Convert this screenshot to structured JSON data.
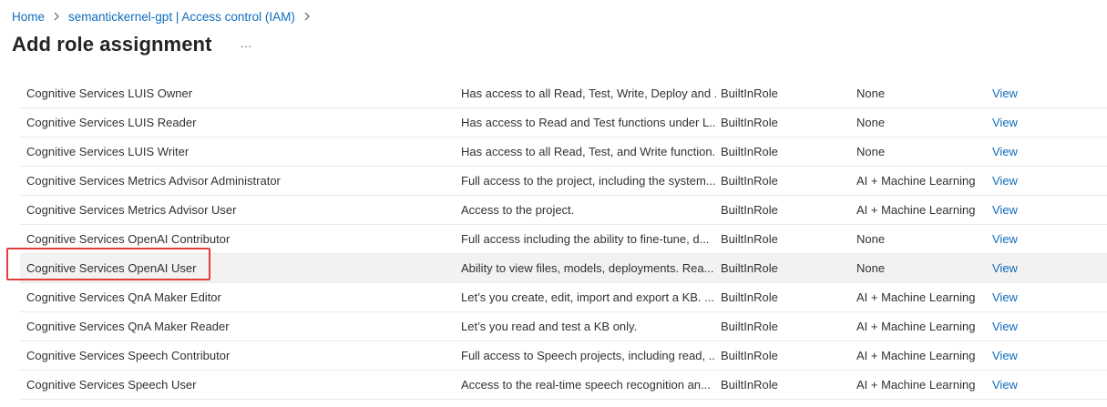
{
  "breadcrumb": {
    "items": [
      "Home",
      "semantickernel-gpt | Access control (IAM)"
    ]
  },
  "page": {
    "title": "Add role assignment",
    "more_label": "···"
  },
  "roles": [
    {
      "name": "Cognitive Services LUIS Owner",
      "description": "Has access to all Read, Test, Write, Deploy and ...",
      "type": "BuiltInRole",
      "category": "None",
      "action": "View"
    },
    {
      "name": "Cognitive Services LUIS Reader",
      "description": "Has access to Read and Test functions under L...",
      "type": "BuiltInRole",
      "category": "None",
      "action": "View"
    },
    {
      "name": "Cognitive Services LUIS Writer",
      "description": "Has access to all Read, Test, and Write function...",
      "type": "BuiltInRole",
      "category": "None",
      "action": "View"
    },
    {
      "name": "Cognitive Services Metrics Advisor Administrator",
      "description": "Full access to the project, including the system...",
      "type": "BuiltInRole",
      "category": "AI + Machine Learning",
      "action": "View"
    },
    {
      "name": "Cognitive Services Metrics Advisor User",
      "description": "Access to the project.",
      "type": "BuiltInRole",
      "category": "AI + Machine Learning",
      "action": "View"
    },
    {
      "name": "Cognitive Services OpenAI Contributor",
      "description": "Full access including the ability to fine-tune, d...",
      "type": "BuiltInRole",
      "category": "None",
      "action": "View"
    },
    {
      "name": "Cognitive Services OpenAI User",
      "description": "Ability to view files, models, deployments. Rea...",
      "type": "BuiltInRole",
      "category": "None",
      "action": "View"
    },
    {
      "name": "Cognitive Services QnA Maker Editor",
      "description": "Let’s you create, edit, import and export a KB. ...",
      "type": "BuiltInRole",
      "category": "AI + Machine Learning",
      "action": "View"
    },
    {
      "name": "Cognitive Services QnA Maker Reader",
      "description": "Let’s you read and test a KB only.",
      "type": "BuiltInRole",
      "category": "AI + Machine Learning",
      "action": "View"
    },
    {
      "name": "Cognitive Services Speech Contributor",
      "description": "Full access to Speech projects, including read, ...",
      "type": "BuiltInRole",
      "category": "AI + Machine Learning",
      "action": "View"
    },
    {
      "name": "Cognitive Services Speech User",
      "description": "Access to the real-time speech recognition an...",
      "type": "BuiltInRole",
      "category": "AI + Machine Learning",
      "action": "View"
    }
  ],
  "selected_index": 6,
  "colors": {
    "link": "#0f6cbd",
    "highlight": "#e03e3e",
    "selected_row": "#f3f2f1"
  }
}
